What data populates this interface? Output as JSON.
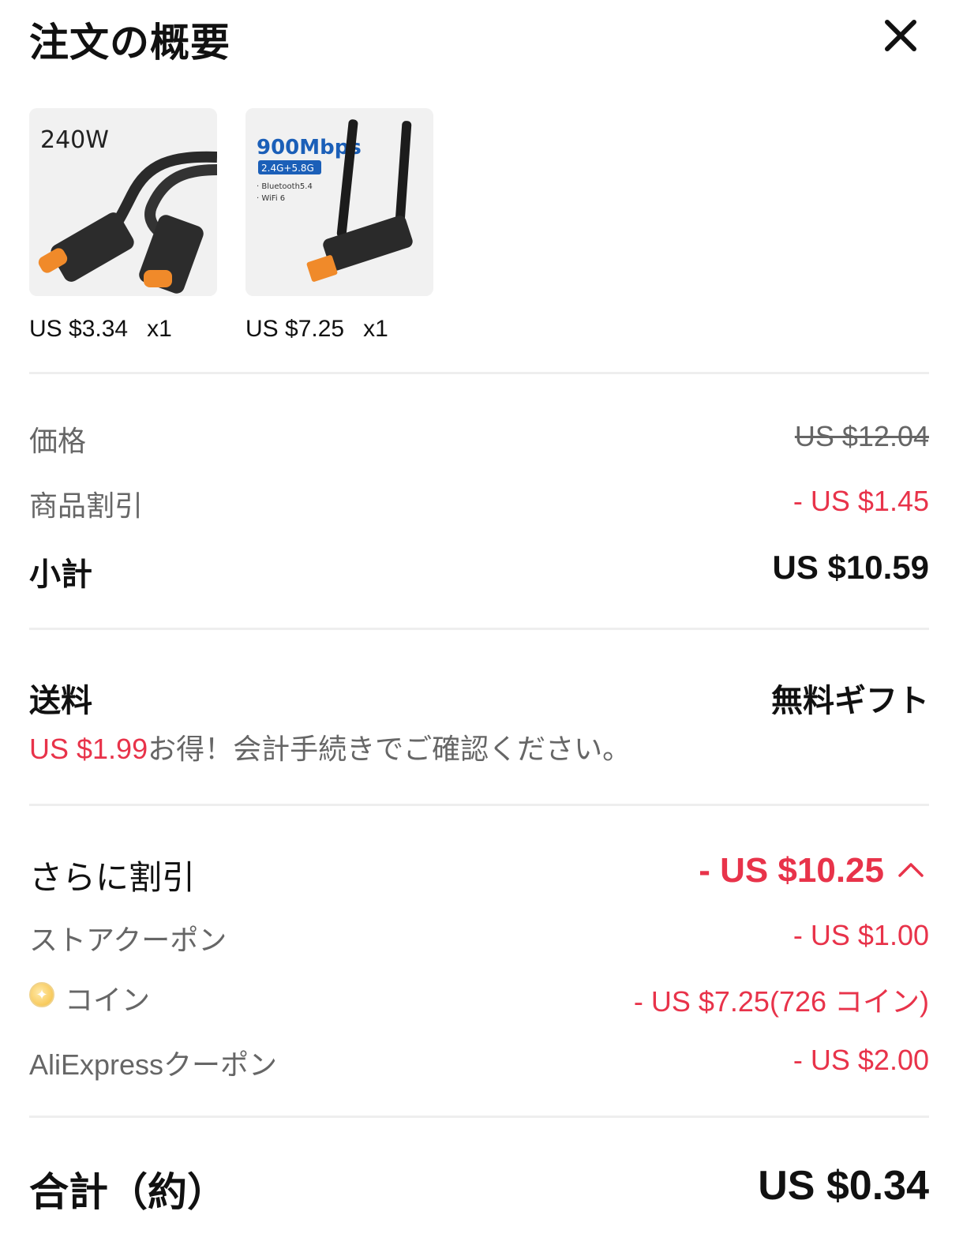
{
  "header": {
    "title": "注文の概要",
    "close_icon": "close-icon"
  },
  "products": [
    {
      "image_text": "240W",
      "price": "US $3.34",
      "qty": "x1"
    },
    {
      "image_text": "900Mbps",
      "image_sub": "2.4G+5.8G",
      "image_line1": "· Bluetooth5.4",
      "image_line2": "· WiFi 6",
      "price": "US $7.25",
      "qty": "x1"
    }
  ],
  "summary": {
    "price_label": "価格",
    "price_value": "US $12.04",
    "product_discount_label": "商品割引",
    "product_discount_value": "- US $1.45",
    "subtotal_label": "小計",
    "subtotal_value": "US $10.59"
  },
  "shipping": {
    "label": "送料",
    "value": "無料ギフト",
    "saving_amount": "US $1.99",
    "saving_text": "お得！会計手続きでご確認ください。"
  },
  "extra_discount": {
    "label": "さらに割引",
    "total": "- US $10.25",
    "toggle_icon": "chevron-up-icon",
    "items": [
      {
        "label": "ストアクーポン",
        "value": "- US $1.00"
      },
      {
        "label": "コイン",
        "value": "- US $7.25(726 コイン)",
        "icon": "coin-icon"
      },
      {
        "label": "AliExpressクーポン",
        "value": "- US $2.00"
      }
    ]
  },
  "total": {
    "label": "合計（約）",
    "value": "US $0.34"
  },
  "colors": {
    "accent_red": "#e8334a",
    "text_dark": "#111111",
    "text_gray": "#666666",
    "divider": "#eeeeee"
  }
}
